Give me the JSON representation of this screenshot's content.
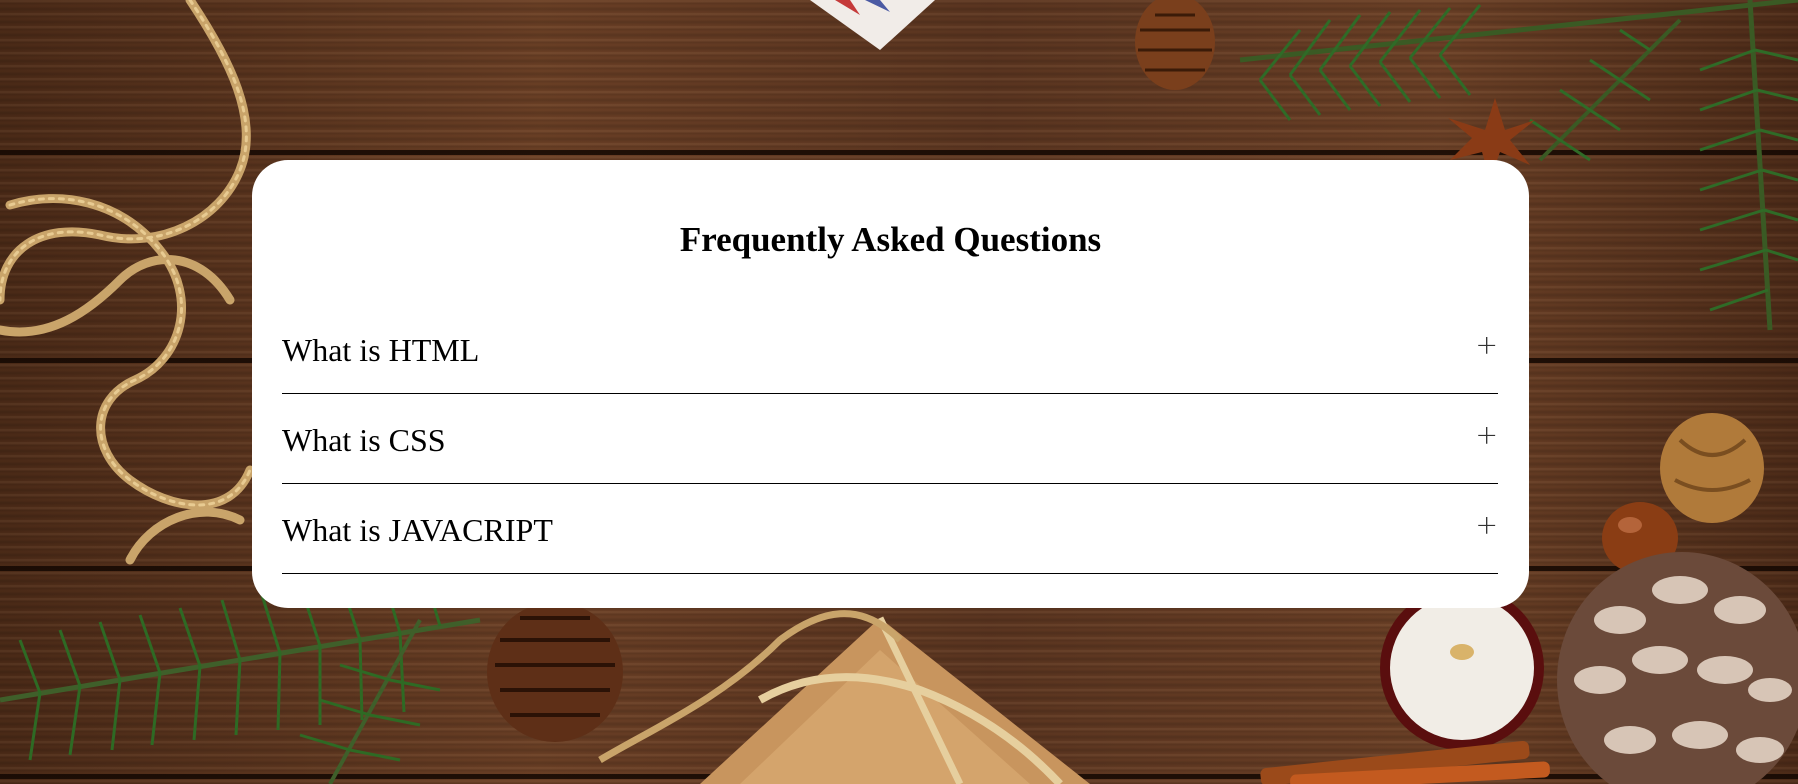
{
  "faq": {
    "title": "Frequently Asked Questions",
    "items": [
      {
        "question": "What is HTML",
        "toggle": "+"
      },
      {
        "question": "What is CSS",
        "toggle": "+"
      },
      {
        "question": "What is JAVACRIPT",
        "toggle": "+"
      }
    ]
  },
  "background": {
    "description_icon": "wooden-table-christmas-decor-image"
  }
}
